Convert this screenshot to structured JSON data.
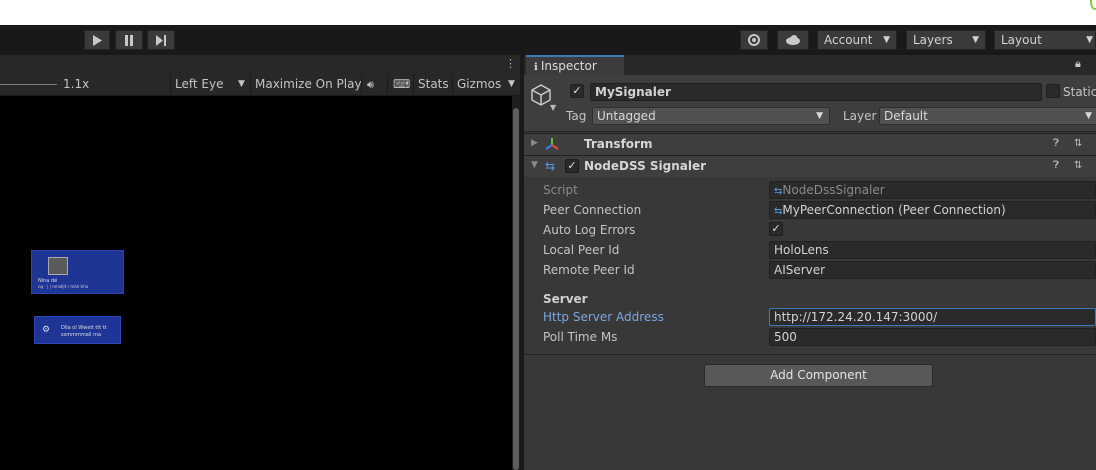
{
  "toolbar": {
    "account_label": "Account",
    "layers_label": "Layers",
    "layout_label": "Layout"
  },
  "game_toolbar": {
    "scale_value": "1.1x",
    "display_label": "Left Eye",
    "maximize_label": "Maximize On Play",
    "stats_label": "Stats",
    "gizmos_label": "Gizmos"
  },
  "game_view": {
    "thumb1_line1": "Nina dé",
    "thumb1_line2": "ng - | | nmiđijt r máh tiha",
    "thumb2_line1": "Dìla ol Wwelt ttt tt",
    "thumb2_line2": "ssmmmmall ma"
  },
  "inspector": {
    "tab_label": "Inspector",
    "object_name": "MySignaler",
    "static_label": "Static",
    "tag_label": "Tag",
    "tag_value": "Untagged",
    "layer_label": "Layer",
    "layer_value": "Default",
    "components": [
      {
        "title": "Transform"
      },
      {
        "title": "NodeDSS Signaler"
      }
    ],
    "fields": {
      "script_label": "Script",
      "script_value": "NodeDssSignaler",
      "peer_connection_label": "Peer Connection",
      "peer_connection_value": "MyPeerConnection (Peer Connection)",
      "auto_log_errors_label": "Auto Log Errors",
      "local_peer_id_label": "Local Peer Id",
      "local_peer_id_value": "HoloLens",
      "remote_peer_id_label": "Remote Peer Id",
      "remote_peer_id_value": "AIServer",
      "server_header": "Server",
      "http_server_address_label": "Http Server Address",
      "http_server_address_value": "http://172.24.20.147:3000/",
      "poll_time_label": "Poll Time Ms",
      "poll_time_value": "500"
    },
    "add_component_label": "Add Component"
  },
  "colors": {
    "accent_blue": "#3a79bb",
    "link_blue": "#7ba6e0",
    "panel_bg": "#383838",
    "game_bg": "#000000"
  }
}
